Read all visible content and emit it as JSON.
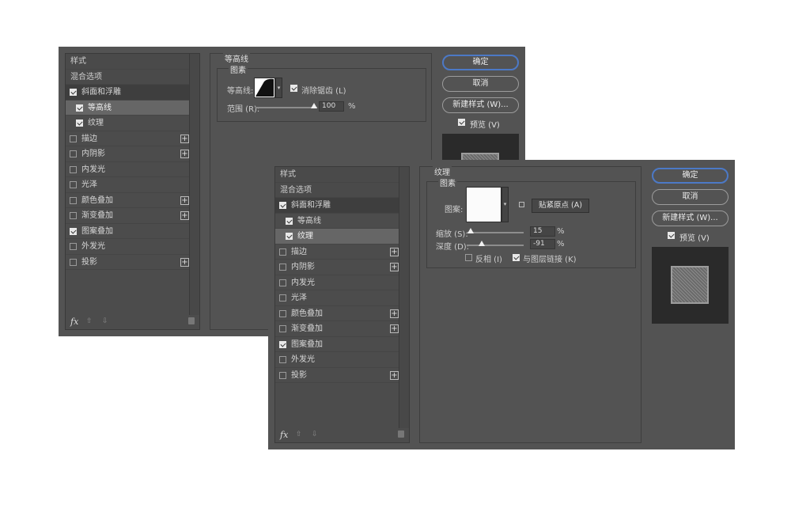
{
  "back_dialog": {
    "styles": {
      "header": "样式",
      "blend": "混合选项",
      "items": [
        {
          "label": "斜面和浮雕",
          "checked": true,
          "indent": false,
          "plus": false
        },
        {
          "label": "等高线",
          "checked": true,
          "indent": true,
          "plus": false
        },
        {
          "label": "纹理",
          "checked": true,
          "indent": true,
          "plus": false
        },
        {
          "label": "描边",
          "checked": false,
          "indent": false,
          "plus": true
        },
        {
          "label": "内阴影",
          "checked": false,
          "indent": false,
          "plus": true
        },
        {
          "label": "内发光",
          "checked": false,
          "indent": false,
          "plus": false
        },
        {
          "label": "光泽",
          "checked": false,
          "indent": false,
          "plus": false
        },
        {
          "label": "颜色叠加",
          "checked": false,
          "indent": false,
          "plus": true
        },
        {
          "label": "渐变叠加",
          "checked": false,
          "indent": false,
          "plus": true
        },
        {
          "label": "图案叠加",
          "checked": true,
          "indent": false,
          "plus": false
        },
        {
          "label": "外发光",
          "checked": false,
          "indent": false,
          "plus": false
        },
        {
          "label": "投影",
          "checked": false,
          "indent": false,
          "plus": true
        }
      ],
      "fx": "fx",
      "up": "⇧",
      "down": "⇩"
    },
    "section_title": "等高线",
    "sub_title": "图素",
    "contour_label": "等高线:",
    "antialias_label": "消除锯齿 (L)",
    "range_label": "范围 (R):",
    "range_value": "100",
    "range_unit": "%",
    "buttons": {
      "ok": "确定",
      "cancel": "取消",
      "new_style": "新建样式 (W)..."
    },
    "preview_label": "预览 (V)"
  },
  "front_dialog": {
    "styles": {
      "header": "样式",
      "blend": "混合选项",
      "items": [
        {
          "label": "斜面和浮雕",
          "checked": true,
          "indent": false,
          "plus": false
        },
        {
          "label": "等高线",
          "checked": true,
          "indent": true,
          "plus": false
        },
        {
          "label": "纹理",
          "checked": true,
          "indent": true,
          "plus": false
        },
        {
          "label": "描边",
          "checked": false,
          "indent": false,
          "plus": true
        },
        {
          "label": "内阴影",
          "checked": false,
          "indent": false,
          "plus": true
        },
        {
          "label": "内发光",
          "checked": false,
          "indent": false,
          "plus": false
        },
        {
          "label": "光泽",
          "checked": false,
          "indent": false,
          "plus": false
        },
        {
          "label": "颜色叠加",
          "checked": false,
          "indent": false,
          "plus": true
        },
        {
          "label": "渐变叠加",
          "checked": false,
          "indent": false,
          "plus": true
        },
        {
          "label": "图案叠加",
          "checked": true,
          "indent": false,
          "plus": false
        },
        {
          "label": "外发光",
          "checked": false,
          "indent": false,
          "plus": false
        },
        {
          "label": "投影",
          "checked": false,
          "indent": false,
          "plus": true
        }
      ],
      "fx": "fx",
      "up": "⇧",
      "down": "⇩"
    },
    "section_title": "纹理",
    "sub_title": "图素",
    "pattern_label": "图案:",
    "snap_origin_label": "贴紧原点 (A)",
    "scale_label": "缩放 (S):",
    "scale_value": "15",
    "scale_unit": "%",
    "depth_label": "深度 (D):",
    "depth_value": "-91",
    "depth_unit": "%",
    "invert_label": "反相 (I)",
    "link_label": "与图层链接 (K)",
    "buttons": {
      "ok": "确定",
      "cancel": "取消",
      "new_style": "新建样式 (W)..."
    },
    "preview_label": "预览 (V)"
  },
  "colors": {
    "dialog_bg": "#535353",
    "accent_border": "#4c79c6"
  }
}
